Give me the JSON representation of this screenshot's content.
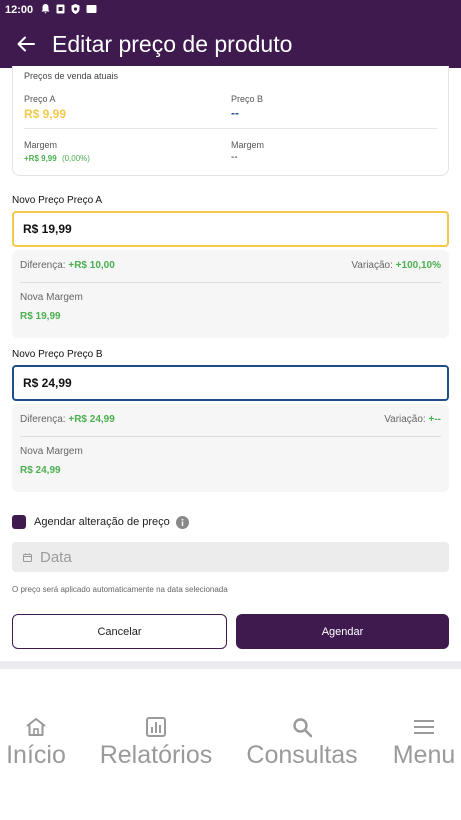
{
  "status_bar": {
    "time": "12:00"
  },
  "app_bar": {
    "title": "Editar preço de produto"
  },
  "current_prices": {
    "title": "Preços de venda atuais",
    "price_a": {
      "label": "Preço A",
      "value": "R$ 9,99"
    },
    "price_b": {
      "label": "Preço B",
      "value": "--"
    },
    "margin_a": {
      "label": "Margem",
      "value": "+R$ 9,99",
      "percent": "(0,00%)"
    },
    "margin_b": {
      "label": "Margem",
      "value": "--"
    }
  },
  "new_price_a": {
    "label": "Novo Preço Preço A",
    "input_value": "R$ 19,99",
    "difference_label": "Diferença:",
    "difference_value": "+R$ 10,00",
    "variation_label": "Variação:",
    "variation_value": "+100,10%",
    "new_margin_label": "Nova Margem",
    "new_margin_value": "R$ 19,99"
  },
  "new_price_b": {
    "label": "Novo Preço Preço B",
    "input_value": "R$ 24,99",
    "difference_label": "Diferença:",
    "difference_value": "+R$ 24,99",
    "variation_label": "Variação:",
    "variation_value": "+--",
    "new_margin_label": "Nova Margem",
    "new_margin_value": "R$ 24,99"
  },
  "schedule": {
    "checkbox_label": "Agendar alteração de preço",
    "checked": true,
    "date_placeholder": "Data",
    "helper_text": "O preço será aplicado automaticamente na data selecionada"
  },
  "actions": {
    "cancel_label": "Cancelar",
    "schedule_label": "Agendar"
  },
  "bottom_nav": [
    {
      "label": "Início",
      "icon": "home-icon"
    },
    {
      "label": "Relatórios",
      "icon": "bar-chart-icon"
    },
    {
      "label": "Consultas",
      "icon": "search-icon"
    },
    {
      "label": "Menu",
      "icon": "menu-icon"
    }
  ],
  "colors": {
    "primary": "#3e1a4f",
    "accent_yellow": "#f2c94c",
    "input_blue": "#1f4e86",
    "positive_green": "#4caf50",
    "price_b_blue": "#1f4e86"
  }
}
